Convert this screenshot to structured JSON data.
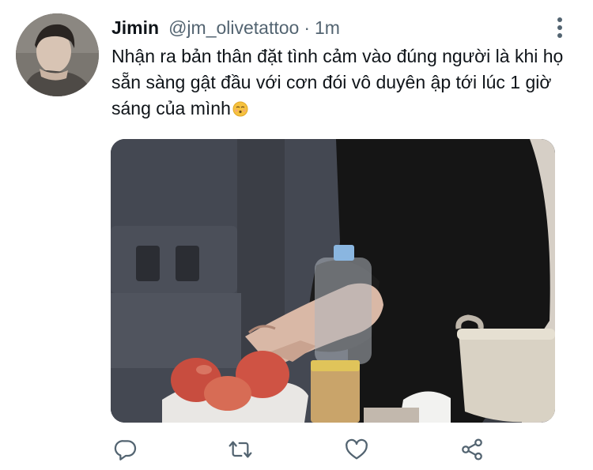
{
  "tweet": {
    "author_name": "Jimin",
    "handle": "@jm_olivetattoo",
    "separator": "·",
    "time": "1m",
    "text": "Nhận ra bản thân đặt tình cảm vào đúng người là khi họ sẵn sàng gật đầu với cơn đói vô duyên ập tới lúc 1 giờ sáng của mình",
    "emoji": "kissing-face-emoji"
  },
  "icons": {
    "more": "more-vertical-icon",
    "reply": "reply-icon",
    "retweet": "retweet-icon",
    "like": "heart-icon",
    "share": "share-icon"
  },
  "colors": {
    "text": "#0f1419",
    "secondary": "#536471",
    "icon": "#536471"
  }
}
